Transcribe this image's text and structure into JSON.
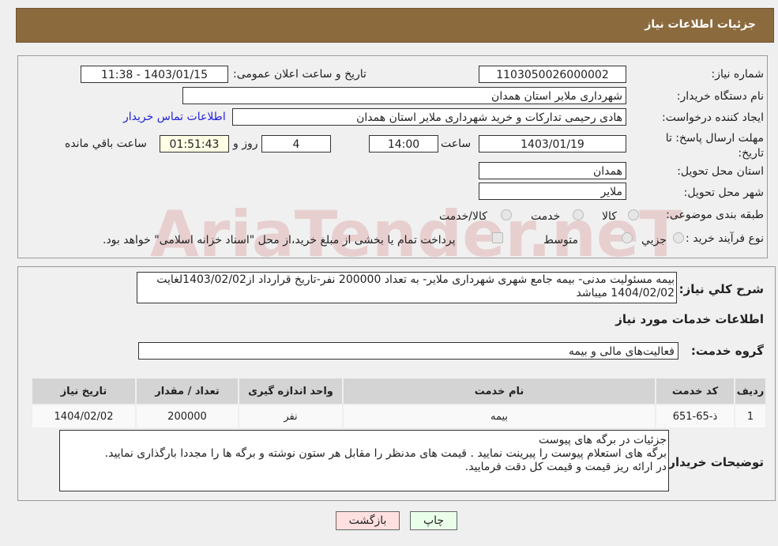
{
  "header": {
    "title": "جزئیات اطلاعات نیاز"
  },
  "form": {
    "need_number_label": "شماره نیاز:",
    "need_number": "1103050026000002",
    "announce_label": "تاریخ و ساعت اعلان عمومی:",
    "announce_value": "1403/01/15 - 11:38",
    "buyer_label": "نام دستگاه خریدار:",
    "buyer_value": "شهرداری ملایر استان همدان",
    "creator_label": "ایجاد کننده درخواست:",
    "creator_value": "هادی رحیمی تداركات و خرید شهرداری ملایر استان همدان",
    "contact_link": "اطلاعات تماس خریدار",
    "deadline_label": "مهلت ارسال پاسخ: تا تاریخ:",
    "deadline_date": "1403/01/19",
    "time_label": "ساعت",
    "deadline_time": "14:00",
    "days": "4",
    "days_label": "روز و",
    "remaining": "01:51:43",
    "remaining_label": "ساعت باقي مانده",
    "province_label": "استان محل تحویل:",
    "province_value": "همدان",
    "city_label": "شهر محل تحویل:",
    "city_value": "ملایر",
    "category_label": "طبقه بندی موضوعی:",
    "category_options": [
      "کالا",
      "خدمت",
      "کالا/خدمت"
    ],
    "process_label": "نوع فرآیند خرید :",
    "process_options": [
      "جزیي",
      "متوسط"
    ],
    "process_note": "پرداخت تمام یا بخشی از مبلغ خرید،از محل \"اسناد خزانه اسلامی\" خواهد بود."
  },
  "watermark": "AriaTender.neT",
  "detail": {
    "description_label": "شرح كلي نياز:",
    "description": "بیمه مسئولیت مدنی- بیمه جامع شهری شهرداری ملایر- به تعداد 200000 نفر-تاریخ قرارداد از1403/02/02لغایت 1404/02/02 میباشد",
    "services_title": "اطلاعات خدمات مورد نیاز",
    "group_label": "گروه خدمت:",
    "group_value": "فعالیت‌های مالی و بیمه",
    "table": {
      "headers": [
        "ردیف",
        "کد خدمت",
        "نام خدمت",
        "واحد اندازه گیری",
        "تعداد / مقدار",
        "تاریخ نیاز"
      ],
      "rows": [
        [
          "1",
          "ذ-65-651",
          "بیمه",
          "نفر",
          "200000",
          "1404/02/02"
        ]
      ]
    },
    "notes_label": "توضیحات خریدار:",
    "notes": [
      "جزئیات در برگه های پیوست",
      "برگه های استعلام پیوست را پیرینت نمایید . قیمت های مدنظر را مقابل هر ستون نوشته و برگه ها را مجددا بارگذاری نمایید.",
      "در ارائه ریز قیمت و قیمت کل دقت فرمایید."
    ]
  },
  "buttons": {
    "print": "چاپ",
    "back": "بازگشت"
  },
  "colors": {
    "header": "#8b6a3e",
    "print_btn": "#eaffea",
    "back_btn": "#ffe0e0",
    "link": "#2222dd"
  }
}
